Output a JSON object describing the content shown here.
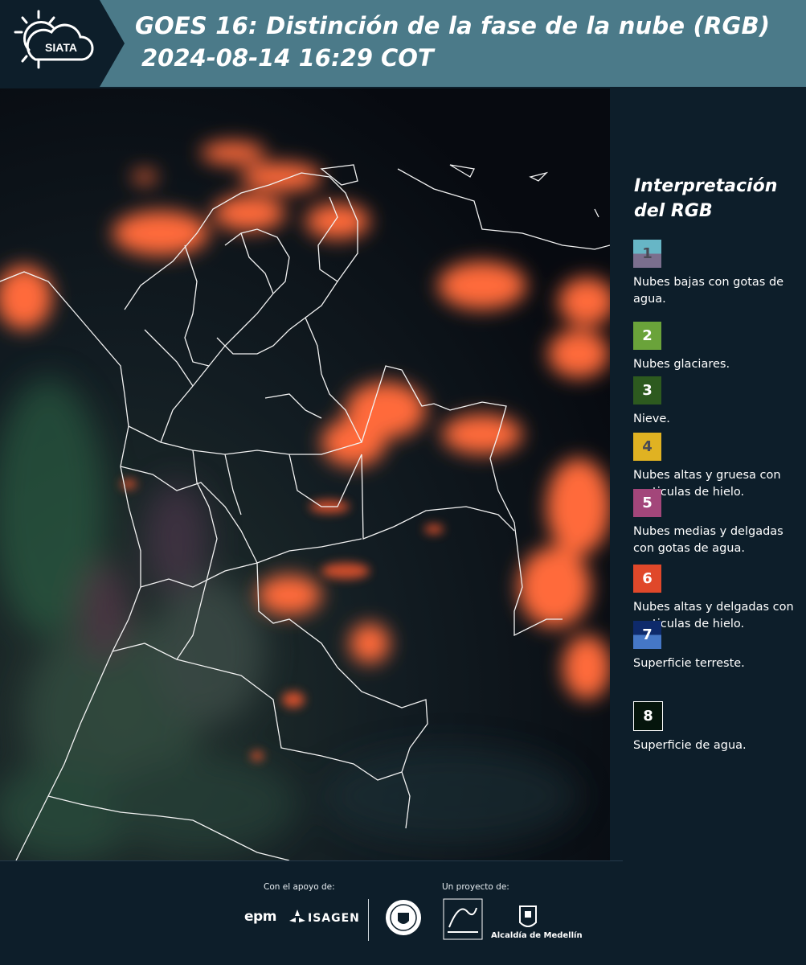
{
  "header": {
    "title": "GOES 16: Distinción de la fase de la nube (RGB)",
    "subtitle": "2024-08-14 16:29 COT",
    "logo_text": "SIATA"
  },
  "legend": {
    "title": "Interpretación del RGB",
    "items": [
      {
        "number": "1",
        "label": "Nubes bajas con gotas de agua.",
        "colors": [
          "#67b6c6",
          "#7b6f8e"
        ],
        "number_color": "#4a4a55"
      },
      {
        "number": "2",
        "label": "Nubes glaciares.",
        "colors": [
          "#6aa33a"
        ],
        "number_color": "#ffffff"
      },
      {
        "number": "3",
        "label": "Nieve.",
        "colors": [
          "#2d5a1f"
        ],
        "number_color": "#ffffff"
      },
      {
        "number": "4",
        "label": "Nubes altas y gruesa con particulas de hielo.",
        "colors": [
          "#e0b222"
        ],
        "number_color": "#4a4a55"
      },
      {
        "number": "5",
        "label": "Nubes medias y delgadas con gotas de agua.",
        "colors": [
          "#a3467a"
        ],
        "number_color": "#ffffff"
      },
      {
        "number": "6",
        "label": "Nubes altas y delgadas con particulas de hielo.",
        "colors": [
          "#e0482a"
        ],
        "number_color": "#ffffff"
      },
      {
        "number": "7",
        "label": "Superficie terreste.",
        "colors": [
          "#0e2a6b",
          "#4577c6"
        ],
        "number_color": "#ffffff"
      },
      {
        "number": "8",
        "label": "Superficie de agua.",
        "colors": [
          "#05150c"
        ],
        "number_color": "#ffffff"
      }
    ]
  },
  "footer": {
    "support_label": "Con el apoyo de:",
    "project_label": "Un proyecto de:",
    "sponsors": [
      "epm",
      "ISAGEN"
    ],
    "partners": [
      "Área Metropolitana Valle de Aburrá",
      "Alcaldía de Medellín"
    ],
    "alcaldia_label": "Alcaldía de Medellín"
  }
}
